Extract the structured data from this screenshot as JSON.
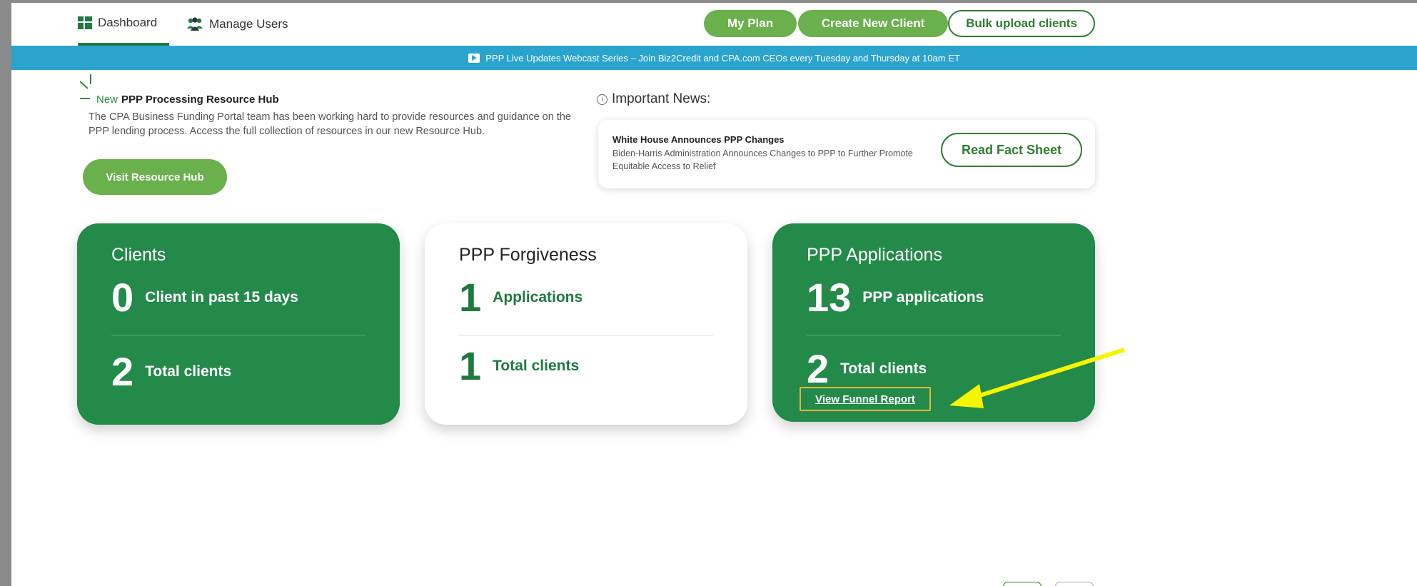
{
  "nav": {
    "tabs": [
      {
        "label": "Dashboard",
        "icon": "dashboard-grid-icon"
      },
      {
        "label": "Manage Users",
        "icon": "users-group-icon"
      }
    ],
    "buttons": {
      "my_plan": "My Plan",
      "create_client": "Create New Client",
      "bulk_upload": "Bulk upload clients"
    }
  },
  "banner": {
    "text": "PPP Live Updates Webcast Series – Join Biz2Credit and CPA.com CEOs every Tuesday and Thursday at 10am ET",
    "icon": "play-icon"
  },
  "hub": {
    "new_tag": "New",
    "title": "PPP Processing Resource Hub",
    "description": "The CPA Business Funding Portal team has been working hard to provide resources and guidance on the PPP lending process. Access the full collection of resources in our new Resource Hub.",
    "button": "Visit Resource Hub"
  },
  "news": {
    "heading": "Important News:",
    "item_title": "White House Announces PPP Changes",
    "item_body": "Biden-Harris Administration Announces Changes to PPP to Further Promote Equitable Access to Relief",
    "button": "Read Fact Sheet"
  },
  "cards": {
    "clients": {
      "title": "Clients",
      "primary_value": "0",
      "primary_label": "Client in past 15 days",
      "secondary_value": "2",
      "secondary_label": "Total clients"
    },
    "forgiveness": {
      "title": "PPP Forgiveness",
      "primary_value": "1",
      "primary_label": "Applications",
      "secondary_value": "1",
      "secondary_label": "Total clients"
    },
    "applications": {
      "title": "PPP Applications",
      "primary_value": "13",
      "primary_label": "PPP applications",
      "secondary_value": "2",
      "secondary_label": "Total clients",
      "link": "View Funnel Report"
    }
  },
  "colors": {
    "brand_green": "#238a4a",
    "light_green": "#6ab04c",
    "banner_blue": "#2aa4cc",
    "highlight_box": "#e6b43c",
    "annotation_arrow": "#f5f500"
  }
}
